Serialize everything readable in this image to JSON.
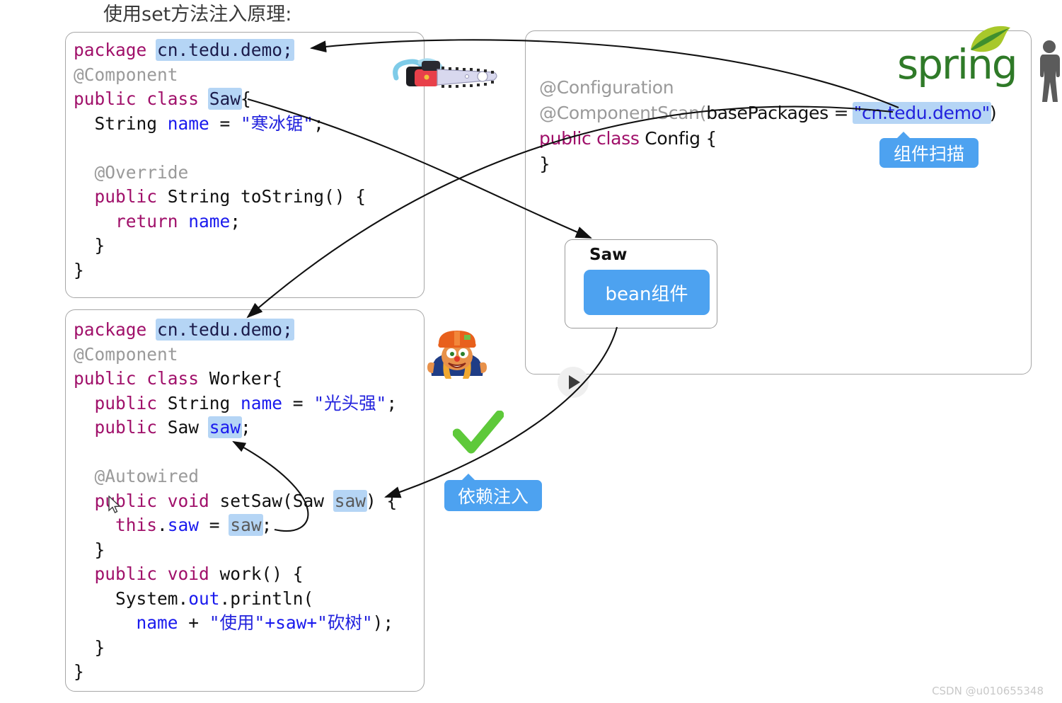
{
  "title": "使用set方法注入原理:",
  "panels": {
    "saw": {
      "name": "Saw class panel",
      "lines": [
        {
          "segments": [
            {
              "t": "package ",
              "c": "kw"
            },
            {
              "t": "cn.tedu.demo;",
              "c": "hl"
            }
          ]
        },
        {
          "segments": [
            {
              "t": "@Component",
              "c": "ann"
            }
          ]
        },
        {
          "segments": [
            {
              "t": "public class ",
              "c": "kw"
            },
            {
              "t": "Saw",
              "c": "hl"
            },
            {
              "t": "{",
              "c": "pln"
            }
          ]
        },
        {
          "segments": [
            {
              "t": "  String ",
              "c": "pln"
            },
            {
              "t": "name",
              "c": "var"
            },
            {
              "t": " = ",
              "c": "pln"
            },
            {
              "t": "\"寒冰锯\"",
              "c": "str"
            },
            {
              "t": ";",
              "c": "pln"
            }
          ]
        },
        {
          "segments": [
            {
              "t": "",
              "c": "pln"
            }
          ]
        },
        {
          "segments": [
            {
              "t": "  @Override",
              "c": "ann"
            }
          ]
        },
        {
          "segments": [
            {
              "t": "  public ",
              "c": "kw"
            },
            {
              "t": "String toString() {",
              "c": "pln"
            }
          ]
        },
        {
          "segments": [
            {
              "t": "    return ",
              "c": "kw"
            },
            {
              "t": "name",
              "c": "var"
            },
            {
              "t": ";",
              "c": "pln"
            }
          ]
        },
        {
          "segments": [
            {
              "t": "  }",
              "c": "pln"
            }
          ]
        },
        {
          "segments": [
            {
              "t": "}",
              "c": "pln"
            }
          ]
        }
      ]
    },
    "worker": {
      "name": "Worker class panel",
      "lines": [
        {
          "segments": [
            {
              "t": "package ",
              "c": "kw"
            },
            {
              "t": "cn.tedu.demo;",
              "c": "hl"
            }
          ]
        },
        {
          "segments": [
            {
              "t": "@Component",
              "c": "ann"
            }
          ]
        },
        {
          "segments": [
            {
              "t": "public class ",
              "c": "kw"
            },
            {
              "t": "Worker{",
              "c": "pln"
            }
          ]
        },
        {
          "segments": [
            {
              "t": "  public ",
              "c": "kw"
            },
            {
              "t": "String ",
              "c": "pln"
            },
            {
              "t": "name",
              "c": "var"
            },
            {
              "t": " = ",
              "c": "pln"
            },
            {
              "t": "\"光头强\"",
              "c": "str"
            },
            {
              "t": ";",
              "c": "pln"
            }
          ]
        },
        {
          "segments": [
            {
              "t": "  public ",
              "c": "kw"
            },
            {
              "t": "Saw ",
              "c": "pln"
            },
            {
              "t": "saw",
              "c": "hlvar"
            },
            {
              "t": ";",
              "c": "pln"
            }
          ]
        },
        {
          "segments": [
            {
              "t": "",
              "c": "pln"
            }
          ]
        },
        {
          "segments": [
            {
              "t": "  @Autowired",
              "c": "ann"
            }
          ]
        },
        {
          "segments": [
            {
              "t": "  public void ",
              "c": "kw"
            },
            {
              "t": "setSaw(Saw ",
              "c": "pln"
            },
            {
              "t": "saw",
              "c": "hldim"
            },
            {
              "t": ") {",
              "c": "pln"
            }
          ]
        },
        {
          "segments": [
            {
              "t": "    this",
              "c": "kw"
            },
            {
              "t": ".",
              "c": "pln"
            },
            {
              "t": "saw",
              "c": "var"
            },
            {
              "t": " = ",
              "c": "pln"
            },
            {
              "t": "saw",
              "c": "hldim"
            },
            {
              "t": ";",
              "c": "pln"
            }
          ]
        },
        {
          "segments": [
            {
              "t": "  }",
              "c": "pln"
            }
          ]
        },
        {
          "segments": [
            {
              "t": "  public void ",
              "c": "kw"
            },
            {
              "t": "work() {",
              "c": "pln"
            }
          ]
        },
        {
          "segments": [
            {
              "t": "    System.",
              "c": "pln"
            },
            {
              "t": "out",
              "c": "var"
            },
            {
              "t": ".println(",
              "c": "pln"
            }
          ]
        },
        {
          "segments": [
            {
              "t": "      ",
              "c": "pln"
            },
            {
              "t": "name",
              "c": "var"
            },
            {
              "t": " + ",
              "c": "pln"
            },
            {
              "t": "\"使用\"",
              "c": "str"
            },
            {
              "t": "+",
              "c": "var"
            },
            {
              "t": "saw",
              "c": "var"
            },
            {
              "t": "+",
              "c": "var"
            },
            {
              "t": "\"砍树\"",
              "c": "str"
            },
            {
              "t": ");",
              "c": "pln"
            }
          ]
        },
        {
          "segments": [
            {
              "t": "  }",
              "c": "pln"
            }
          ]
        },
        {
          "segments": [
            {
              "t": "}",
              "c": "pln"
            }
          ]
        }
      ]
    },
    "config": {
      "name": "Spring container panel",
      "lines": [
        {
          "segments": [
            {
              "t": "@Configuration",
              "c": "ann"
            }
          ]
        },
        {
          "segments": [
            {
              "t": "@ComponentScan(",
              "c": "ann"
            },
            {
              "t": "basePackages",
              "c": "pln"
            },
            {
              "t": " = ",
              "c": "pln"
            },
            {
              "t": "\"cn.tedu.demo\"",
              "c": "hlstr"
            },
            {
              "t": ")",
              "c": "pln"
            }
          ]
        },
        {
          "segments": [
            {
              "t": "public class ",
              "c": "kw"
            },
            {
              "t": "Config {",
              "c": "pln"
            }
          ]
        },
        {
          "segments": [
            {
              "t": "}",
              "c": "pln"
            }
          ]
        }
      ]
    }
  },
  "bean_box": {
    "title": "Saw",
    "chip_label": "bean组件"
  },
  "badges": {
    "component_scan": "组件扫描",
    "dependency_injection": "依赖注入"
  },
  "logo": {
    "text": "spring",
    "leaf": "spring-leaf-icon"
  },
  "icons": {
    "chainsaw": "chainsaw-icon",
    "worker": "lumberjack-character-icon",
    "person": "person-silhouette-icon",
    "check": "green-check-icon",
    "play": "play-button-icon",
    "cursor": "mouse-cursor-icon"
  },
  "watermark": "CSDN @u010655348",
  "colors": {
    "highlight": "#b5d5f5",
    "badge_blue": "#4da2f0",
    "keyword": "#a0106a",
    "annotation": "#9a9a9a",
    "string": "#2222dd",
    "spring_green": "#2f7a28",
    "check_green": "#5ec93a",
    "panel_border": "#a6a6a6"
  }
}
